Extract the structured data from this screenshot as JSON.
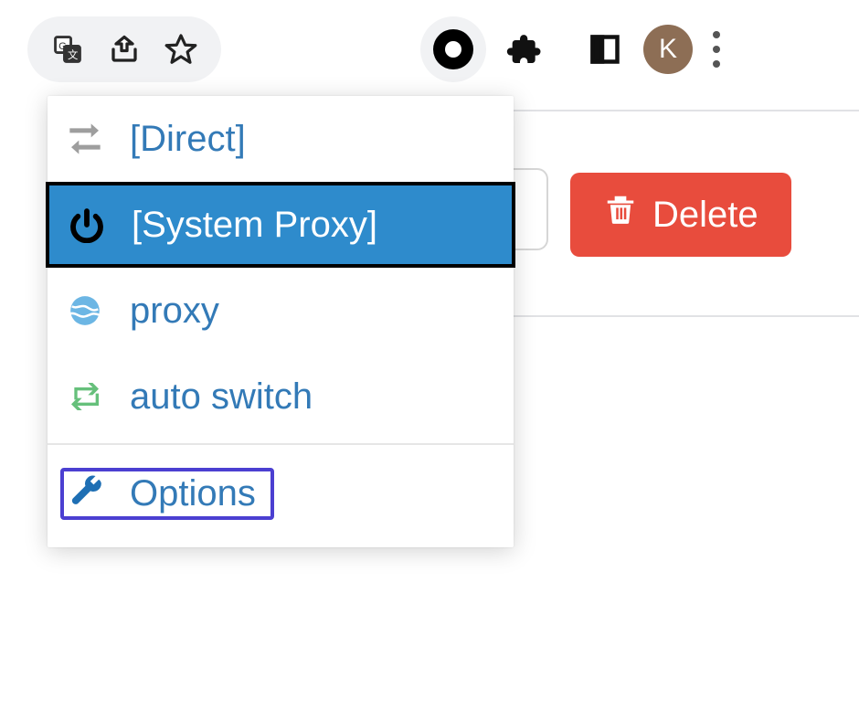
{
  "toolbar": {
    "translate_icon": "translate-icon",
    "share_icon": "share-icon",
    "star_icon": "star-icon"
  },
  "extensions": {
    "main_ext_icon": "switchyomega-icon",
    "puzzle_icon": "extensions-icon",
    "panel_icon": "sidepanel-icon",
    "avatar_initial": "K",
    "overflow_icon": "kebab-menu-icon"
  },
  "popup": {
    "items": [
      {
        "label": "[Direct]",
        "icon": "arrows",
        "selected": false
      },
      {
        "label": "[System Proxy]",
        "icon": "power",
        "selected": true
      },
      {
        "label": "proxy",
        "icon": "globe",
        "selected": false
      },
      {
        "label": "auto switch",
        "icon": "retweet",
        "selected": false
      }
    ],
    "options_label": "Options"
  },
  "button": {
    "delete_label": "Delete"
  }
}
